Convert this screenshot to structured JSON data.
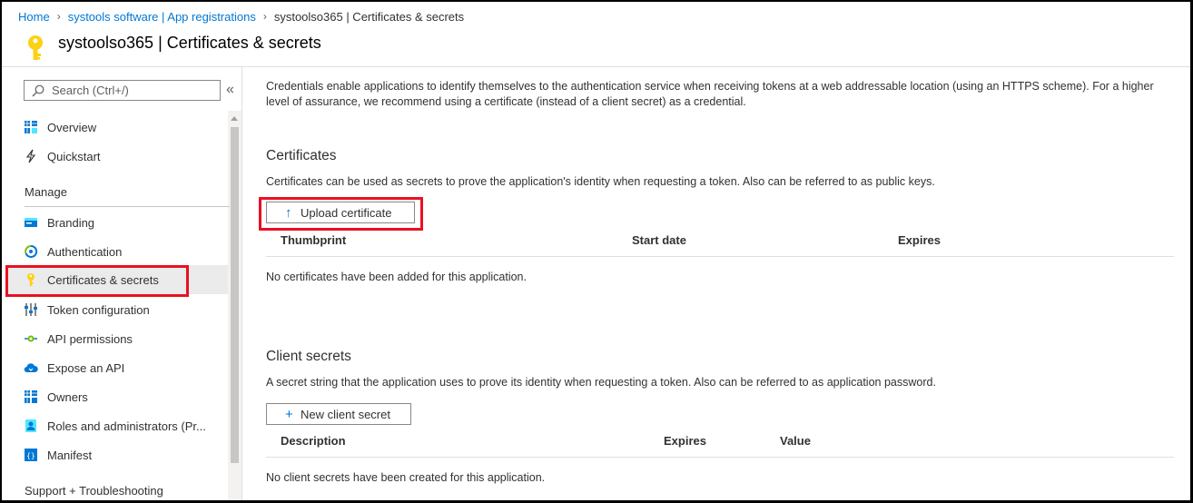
{
  "breadcrumb": {
    "items": [
      "Home",
      "systools software | App registrations"
    ],
    "current": "systoolso365 | Certificates & secrets"
  },
  "header": {
    "title": "systoolso365 | Certificates & secrets",
    "icon": "key-icon"
  },
  "sidebar": {
    "search_placeholder": "Search (Ctrl+/)",
    "collapse_label": "«",
    "top_items": [
      {
        "label": "Overview",
        "icon": "grid-icon"
      },
      {
        "label": "Quickstart",
        "icon": "lightning-icon"
      }
    ],
    "manage_heading": "Manage",
    "manage_items": [
      {
        "label": "Branding",
        "icon": "branding-icon"
      },
      {
        "label": "Authentication",
        "icon": "authentication-icon"
      },
      {
        "label": "Certificates & secrets",
        "icon": "key-icon",
        "selected": true
      },
      {
        "label": "Token configuration",
        "icon": "token-icon"
      },
      {
        "label": "API permissions",
        "icon": "api-permissions-icon"
      },
      {
        "label": "Expose an API",
        "icon": "cloud-icon"
      },
      {
        "label": "Owners",
        "icon": "owners-icon"
      },
      {
        "label": "Roles and administrators (Pr...",
        "icon": "roles-icon"
      },
      {
        "label": "Manifest",
        "icon": "manifest-icon"
      }
    ],
    "support_heading": "Support + Troubleshooting"
  },
  "main": {
    "intro": "Credentials enable applications to identify themselves to the authentication service when receiving tokens at a web addressable location (using an HTTPS scheme). For a higher level of assurance, we recommend using a certificate (instead of a client secret) as a credential.",
    "certificates": {
      "heading": "Certificates",
      "description": "Certificates can be used as secrets to prove the application's identity when requesting a token. Also can be referred to as public keys.",
      "upload_label": "Upload certificate",
      "upload_icon": "↑",
      "columns": [
        "Thumbprint",
        "Start date",
        "Expires"
      ],
      "empty": "No certificates have been added for this application."
    },
    "secrets": {
      "heading": "Client secrets",
      "description": "A secret string that the application uses to prove its identity when requesting a token. Also can be referred to as application password.",
      "new_label": "New client secret",
      "new_icon": "+",
      "columns": [
        "Description",
        "Expires",
        "Value"
      ],
      "empty": "No client secrets have been created for this application."
    }
  },
  "colors": {
    "accent": "#0078d4",
    "highlight": "#e81123",
    "key": "#fcd116"
  }
}
